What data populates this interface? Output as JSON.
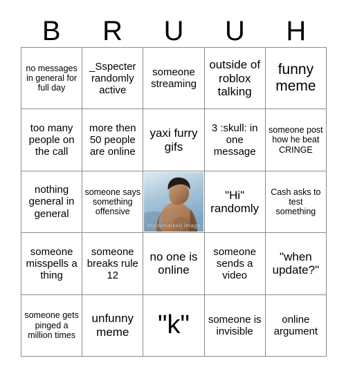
{
  "card": {
    "title_letters": [
      "B",
      "R",
      "U",
      "U",
      "H"
    ],
    "grid_size": "5x5",
    "border_color": "#8a8a8a",
    "background_color": "#ffffff",
    "text_color": "#000000"
  },
  "cells": [
    {
      "text": "no messages in general for full day",
      "size": "xs",
      "type": "text"
    },
    {
      "text": "_Sspecter randomly active",
      "size": "s",
      "type": "text"
    },
    {
      "text": "someone streaming",
      "size": "s",
      "type": "text"
    },
    {
      "text": "outside of roblox talking",
      "size": "m",
      "type": "text"
    },
    {
      "text": "funny meme",
      "size": "l",
      "type": "text"
    },
    {
      "text": "too many people on the call",
      "size": "s",
      "type": "text"
    },
    {
      "text": "more then 50 people are online",
      "size": "s",
      "type": "text"
    },
    {
      "text": "yaxi furry gifs",
      "size": "m",
      "type": "text"
    },
    {
      "text": "3 :skull: in one message",
      "size": "s",
      "type": "text"
    },
    {
      "text": "someone post how he beat CRINGE",
      "size": "xs",
      "type": "text"
    },
    {
      "text": "nothing general in general",
      "size": "s",
      "type": "text"
    },
    {
      "text": "someone says something offensive",
      "size": "xs",
      "type": "text"
    },
    {
      "text": "",
      "size": "s",
      "type": "image",
      "image_alt": "shirtless man in boxing pose photo",
      "image_watermark": "Watermarked Image"
    },
    {
      "text": "\"Hi\" randomly",
      "size": "m",
      "type": "text"
    },
    {
      "text": "Cash asks to test something",
      "size": "xs",
      "type": "text"
    },
    {
      "text": "someone misspells a thing",
      "size": "s",
      "type": "text"
    },
    {
      "text": "someone breaks rule 12",
      "size": "s",
      "type": "text"
    },
    {
      "text": "no one is online",
      "size": "m",
      "type": "text"
    },
    {
      "text": "someone sends a video",
      "size": "s",
      "type": "text"
    },
    {
      "text": "\"when update?\"",
      "size": "m",
      "type": "text"
    },
    {
      "text": "someone gets pinged a million times",
      "size": "xs",
      "type": "text"
    },
    {
      "text": "unfunny meme",
      "size": "m",
      "type": "text"
    },
    {
      "text": "\"k\"",
      "size": "xl",
      "type": "text"
    },
    {
      "text": "someone is invisible",
      "size": "s",
      "type": "text"
    },
    {
      "text": "online argument",
      "size": "s",
      "type": "text"
    }
  ]
}
